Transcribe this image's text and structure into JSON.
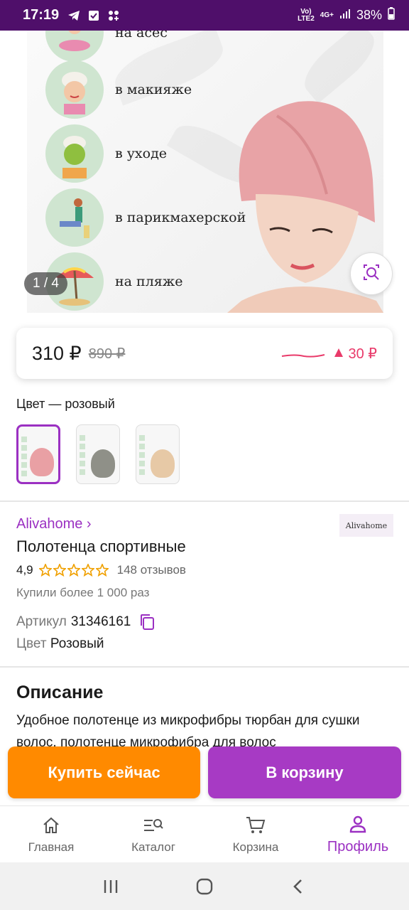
{
  "status_bar": {
    "time": "17:19",
    "network_top": "Vo)",
    "network_bottom": "LTE2",
    "network_type": "4G+",
    "battery": "38%"
  },
  "gallery": {
    "features": [
      {
        "label": "на асес"
      },
      {
        "label": "в макияже"
      },
      {
        "label": "в уходе"
      },
      {
        "label": "в парикмахерской"
      },
      {
        "label": "на пляже"
      }
    ],
    "counter": "1 / 4"
  },
  "price": {
    "current": "310 ₽",
    "old": "890 ₽",
    "delta": "30 ₽",
    "accent_color": "#e93a6a"
  },
  "color_section": {
    "title": "Цвет — розовый",
    "swatches": [
      {
        "name": "pink",
        "color": "#e9a0a4",
        "selected": true
      },
      {
        "name": "grey",
        "color": "#8f9088",
        "selected": false
      },
      {
        "name": "beige",
        "color": "#e7c9a6",
        "selected": false
      }
    ]
  },
  "product": {
    "brand": "Alivahome ›",
    "brand_logo": "Alivahome",
    "title": "Полотенца спортивные",
    "rating": "4,9",
    "stars": 5,
    "reviews": "148 отзывов",
    "bought": "Купили более 1 000 раз",
    "sku_label": "Артикул",
    "sku": "31346161",
    "color_label": "Цвет",
    "color_value": "Розовый"
  },
  "description": {
    "title": "Описание",
    "text": "Удобное полотенце из микрофибры тюрбан для сушки волос, полотенце микрофибра для волос"
  },
  "actions": {
    "buy_now": "Купить сейчас",
    "add_to_cart": "В корзину"
  },
  "bottom_nav": [
    {
      "label": "Главная",
      "icon": "home-icon"
    },
    {
      "label": "Каталог",
      "icon": "catalog-search-icon"
    },
    {
      "label": "Корзина",
      "icon": "cart-icon"
    },
    {
      "label": "Профиль",
      "icon": "profile-icon"
    }
  ],
  "colors": {
    "brand": "#9b30c2",
    "status_bar": "#4f0f6a",
    "buy": "#ff8a00",
    "cart": "#a73ac4"
  }
}
